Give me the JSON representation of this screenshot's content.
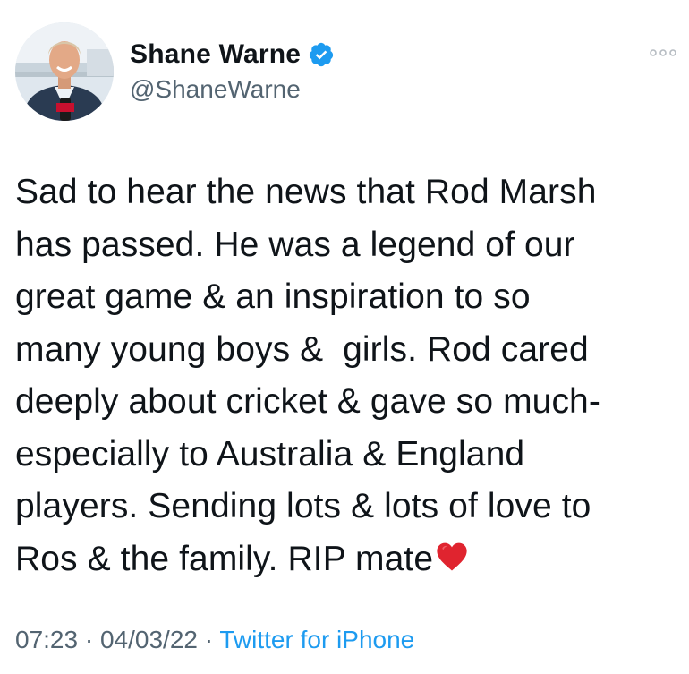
{
  "author": {
    "display_name": "Shane Warne",
    "handle": "@ShaneWarne",
    "verified": true,
    "avatar_icon": "profile-photo",
    "verified_color": "#1d9bf0"
  },
  "more_icon": "more-horizontal-icon",
  "tweet": {
    "text": "Sad to hear the news that Rod Marsh\nhas passed. He was a legend of our\ngreat game & an inspiration to so\nmany young boys &  girls. Rod cared\ndeeply about cricket & gave so much-\nespecially to Australia & England\nplayers. Sending lots & lots of love to\nRos & the family. RIP mate",
    "emoji": "red-heart-icon"
  },
  "meta": {
    "time": "07:23",
    "separator": " · ",
    "date": "04/03/22",
    "source": "Twitter for iPhone"
  },
  "colors": {
    "text": "#0f1419",
    "secondary": "#536471",
    "link": "#1d9bf0",
    "heart": "#e0242f"
  }
}
